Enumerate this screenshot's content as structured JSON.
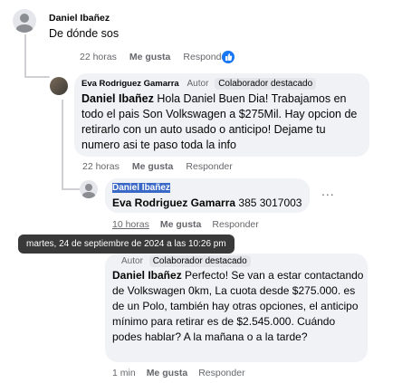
{
  "comment1": {
    "author": "Daniel Ibañez",
    "text": "De dónde sos",
    "time": "22 horas",
    "like": "Me gusta",
    "reply": "Responder"
  },
  "comment2": {
    "author": "Eva Rodriguez Gamarra",
    "role": "Autor",
    "badge": "Colaborador destacado",
    "mention": "Daniel Ibañez",
    "text": " Hola Daniel Buen Dia! Trabajamos en todo el pais Son Volkswagen a $275Mil. Hay opcion de retirarlo con un auto usado o anticipo! Dejame tu numero asi te paso toda la info",
    "time": "22 horas",
    "like": "Me gusta",
    "reply": "Responder"
  },
  "comment3": {
    "author": "Daniel Ibañez",
    "mention": "Eva Rodriguez Gamarra",
    "text": " 385 3017003",
    "time": "10 horas",
    "like": "Me gusta",
    "reply": "Responder",
    "more": "..."
  },
  "tooltip": "martes, 24 de septiembre de 2024 a las 10:26 pm",
  "comment4": {
    "role": "Autor",
    "badge": "Colaborador destacado",
    "mention": "Daniel Ibañez",
    "text": " Perfecto! Se van a estar contactando de Volkswagen 0km, La cuota desde $275.000. es de un Polo, también hay otras opciones, el anticipo mínimo para retirar es de $2.545.000. Cuándo podes hablar? A la mañana o a la tarde?",
    "time": "1 min",
    "like": "Me gusta",
    "reply": "Responder"
  },
  "colors": {
    "accent": "#1877f2",
    "bubble": "#f0f2f5",
    "muted": "#65676b"
  }
}
